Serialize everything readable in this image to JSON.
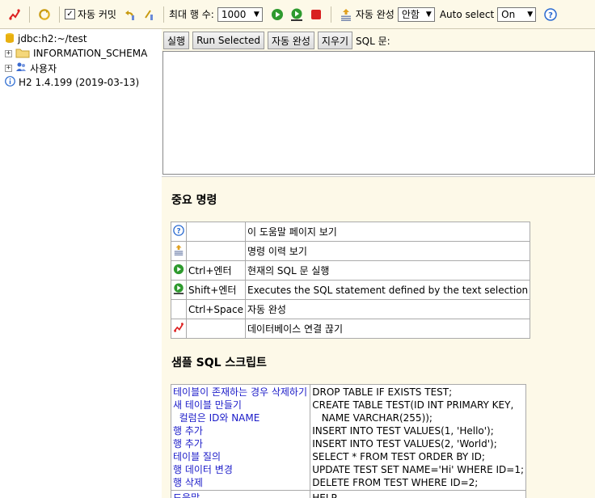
{
  "toolbar": {
    "autocommit_label": "자동 커밋",
    "max_rows_label": "최대 행 수:",
    "max_rows_value": "1000",
    "autocomplete_label": "자동 완성",
    "autocomplete_value": "안함",
    "autoselect_label": "Auto select",
    "autoselect_value": "On"
  },
  "tree": {
    "connection": "jdbc:h2:~/test",
    "schema": "INFORMATION_SCHEMA",
    "users": "사용자",
    "version": "H2 1.4.199 (2019-03-13)"
  },
  "sql_bar": {
    "run": "실행",
    "run_selected": "Run Selected",
    "autocomplete": "자동 완성",
    "clear": "지우기",
    "sql_label": "SQL 문:"
  },
  "help": {
    "title": "중요 명령",
    "commands": [
      {
        "icon": "help-icon",
        "key": "",
        "desc": "이 도움말 페이지 보기"
      },
      {
        "icon": "history-icon",
        "key": "",
        "desc": "명령 이력 보기"
      },
      {
        "icon": "run-icon",
        "key": "Ctrl+엔터",
        "desc": "현재의 SQL 문 실행"
      },
      {
        "icon": "run-selected-icon",
        "key": "Shift+엔터",
        "desc": "Executes the SQL statement defined by the text selection"
      },
      {
        "icon": "",
        "key": "Ctrl+Space",
        "desc": "자동 완성"
      },
      {
        "icon": "disconnect-icon",
        "key": "",
        "desc": "데이터베이스 연결 끊기"
      }
    ],
    "sample_title": "샘플 SQL 스크립트",
    "samples": [
      {
        "label": "테이블이 존재하는 경우 삭제하기",
        "sql": "DROP TABLE IF EXISTS TEST;"
      },
      {
        "label": "새 테이블 만들기",
        "sql": "CREATE TABLE TEST(ID INT PRIMARY KEY,"
      },
      {
        "label": "  컬럼은 ID와 NAME",
        "sql": "   NAME VARCHAR(255));"
      },
      {
        "label": "행 추가",
        "sql": "INSERT INTO TEST VALUES(1, 'Hello');"
      },
      {
        "label": "행 추가",
        "sql": "INSERT INTO TEST VALUES(2, 'World');"
      },
      {
        "label": "테이블 질의",
        "sql": "SELECT * FROM TEST ORDER BY ID;"
      },
      {
        "label": "행 데이터 변경",
        "sql": "UPDATE TEST SET NAME='Hi' WHERE ID=1;"
      },
      {
        "label": "행 삭제",
        "sql": "DELETE FROM TEST WHERE ID=2;"
      }
    ],
    "bottom_label": "도움말",
    "bottom_sql": "HELP ..."
  }
}
